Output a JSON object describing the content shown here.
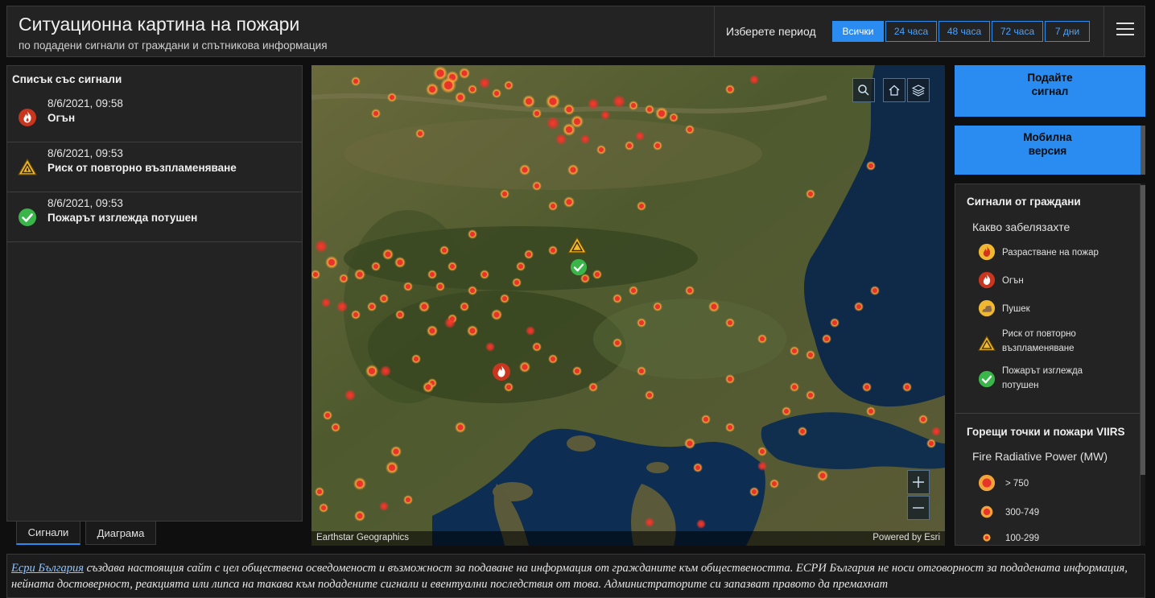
{
  "header": {
    "title": "Ситуационна картина на пожари",
    "subtitle": "по подадени сигнали от граждани и спътникова информация",
    "period_label": "Изберете период",
    "periods": [
      "Всички",
      "24 часа",
      "48 часа",
      "72 часа",
      "7 дни"
    ],
    "active_period": "Всички"
  },
  "signals_panel": {
    "title": "Списък със сигнали",
    "items": [
      {
        "time": "8/6/2021, 09:58",
        "label": "Огън",
        "icon": "fire-icon"
      },
      {
        "time": "8/6/2021, 09:53",
        "label": "Риск от повторно възпламеняване",
        "icon": "warning-icon"
      },
      {
        "time": "8/6/2021, 09:53",
        "label": "Пожарът изглежда потушен",
        "icon": "check-icon"
      }
    ]
  },
  "tabs": [
    "Сигнали",
    "Диаграма"
  ],
  "map": {
    "attribution_left": "Earthstar Geographics",
    "attribution_right": "Powered by Esri",
    "controls": [
      "search-icon",
      "home-icon",
      "layers-icon",
      "zoom-in-icon",
      "zoom-out-icon"
    ]
  },
  "buttons": {
    "report": [
      "Подайте",
      "сигнал"
    ],
    "mobile": [
      "Мобилна",
      "версия"
    ]
  },
  "legend": {
    "citizens_title": "Сигнали от граждани",
    "citizens_subtitle": "Какво забелязахте",
    "citizens_items": [
      {
        "label": "Разрастване на пожар",
        "icon": "fire-spread-icon"
      },
      {
        "label": "Огън",
        "icon": "fire-icon"
      },
      {
        "label": "Пушек",
        "icon": "smoke-icon"
      },
      {
        "label_line1": "Риск от повторно",
        "label_line2": "възпламеняване",
        "icon": "warning-icon"
      },
      {
        "label_line1": "Пожарът изглежда",
        "label_line2": "потушен",
        "icon": "check-icon"
      }
    ],
    "viirs_title": "Горещи точки и пожари VIIRS",
    "viirs_subtitle": "Fire Radiative Power (MW)",
    "viirs_items": [
      "> 750",
      "300-749",
      "100-299"
    ],
    "colors": {
      "hotspot": "#e8332a",
      "hotspot_glow": "#f2a43a"
    }
  },
  "footer": {
    "link_text": "Есри България",
    "text": " създава настоящия сайт с цел обществена осведоменост и възможност за подаване на информация от гражданите към обществеността. ЕСРИ България не носи отговорност за подадената информация, нейната достоверност, реакцията или липса на такава към подадените сигнали и евентуални последствия от това. Администраторите си запазват правото да премахнат"
  },
  "colors": {
    "accent": "#2a8cf0",
    "panel_bg": "#232323"
  }
}
